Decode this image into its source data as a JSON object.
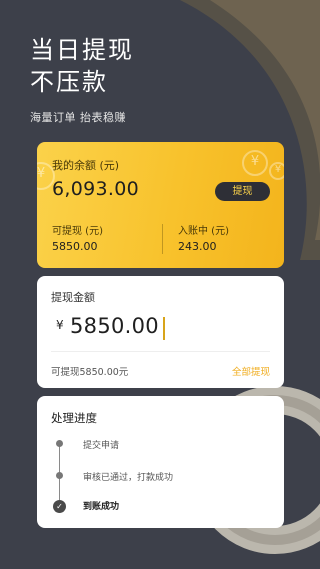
{
  "hero": {
    "title_line1": "当日提现",
    "title_line2": "不压款",
    "subtitle": "海量订单 抬表稳赚"
  },
  "balance": {
    "label": "我的余额 (元)",
    "value": "6,093.00",
    "withdraw_button": "提现",
    "available_label": "可提现 (元)",
    "available_value": "5850.00",
    "pending_label": "入账中 (元)",
    "pending_value": "243.00",
    "coin_symbol": "¥"
  },
  "amount": {
    "label": "提现金额",
    "currency": "¥",
    "value": "5850.00",
    "available_hint": "可提现5850.00元",
    "withdraw_all": "全部提现"
  },
  "progress": {
    "title": "处理进度",
    "steps": [
      {
        "label": "提交申请"
      },
      {
        "label": "审核已通过，打款成功"
      },
      {
        "label": "到账成功"
      }
    ],
    "check_icon": "✓"
  },
  "colors": {
    "background": "#3d404a",
    "accent": "#f8c22c",
    "link": "#f0ac1d"
  }
}
